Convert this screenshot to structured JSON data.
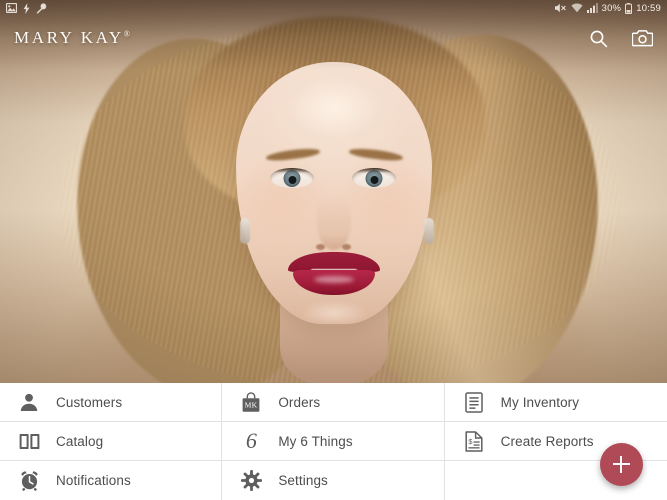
{
  "status_bar": {
    "left_icons": [
      "image-icon",
      "flash-icon",
      "wrench-icon"
    ],
    "right_icons": [
      "mute-icon",
      "wifi-icon",
      "signal-icon",
      "battery-icon"
    ],
    "battery": "30%",
    "time": "10:59"
  },
  "app_bar": {
    "brand": "MARY KAY",
    "brand_mark": "®",
    "actions": [
      {
        "name": "search-button",
        "icon": "search-icon"
      },
      {
        "name": "camera-button",
        "icon": "camera-icon"
      }
    ]
  },
  "hero": {
    "alt": "Model portrait with bold red lipstick and blonde hair",
    "description": "Mary Kay beauty campaign photograph"
  },
  "menu": {
    "items": [
      {
        "label": "Customers",
        "icon": "person-icon",
        "name": "menu-item-customers"
      },
      {
        "label": "Orders",
        "icon": "mk-bag-icon",
        "name": "menu-item-orders"
      },
      {
        "label": "My Inventory",
        "icon": "clipboard-icon",
        "name": "menu-item-my-inventory"
      },
      {
        "label": "Catalog",
        "icon": "open-book-icon",
        "name": "menu-item-catalog"
      },
      {
        "label": "My 6 Things",
        "icon": "numeral-6-icon",
        "name": "menu-item-my-6-things"
      },
      {
        "label": "Create Reports",
        "icon": "dollar-doc-icon",
        "name": "menu-item-create-reports"
      },
      {
        "label": "Notifications",
        "icon": "alarm-clock-icon",
        "name": "menu-item-notifications"
      },
      {
        "label": "Settings",
        "icon": "gear-icon",
        "name": "menu-item-settings"
      }
    ],
    "bag_initials": "MK",
    "six_glyph": "6"
  },
  "fab": {
    "name": "add-button",
    "icon": "plus-icon",
    "color": "#b04a57"
  },
  "colors": {
    "accent": "#b04a57",
    "menu_text": "#4d4d4d",
    "menu_icon": "#5f5f5f",
    "divider": "#e2e2e2",
    "menu_background": "#ffffff"
  }
}
